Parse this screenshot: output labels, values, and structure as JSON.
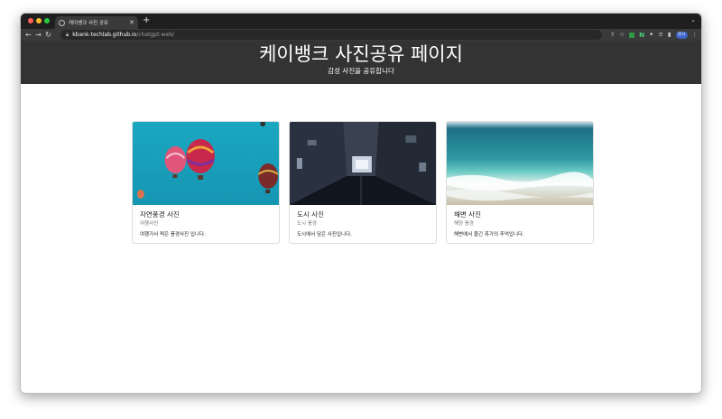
{
  "browser": {
    "tab_title": "케이뱅크 사진 공유",
    "new_tab_label": "+",
    "url_host": "kbank-techlab.github.io",
    "url_path": "/chatgpt-web/",
    "profile_label": "일시"
  },
  "hero": {
    "title": "케이뱅크 사진공유 페이지",
    "subtitle": "감성 사진을 공유합니다"
  },
  "cards": [
    {
      "title": "자연풍경 사진",
      "subtitle": "여행사진",
      "text": "여행가서 찍은 풍경사진 입니다.",
      "image": "hot-air-balloons-photo"
    },
    {
      "title": "도시 사진",
      "subtitle": "도시 풍경",
      "text": "도시에서 담은 사진입니다.",
      "image": "night-alley-photo"
    },
    {
      "title": "해변 사진",
      "subtitle": "해양 풍경",
      "text": "해변에서 즐긴 휴가의 추억입니다.",
      "image": "beach-waves-photo"
    }
  ],
  "colors": {
    "hero_bg": "#333333",
    "tabstrip_bg": "#1f1f1f",
    "toolbar_bg": "#3a3a3a"
  }
}
